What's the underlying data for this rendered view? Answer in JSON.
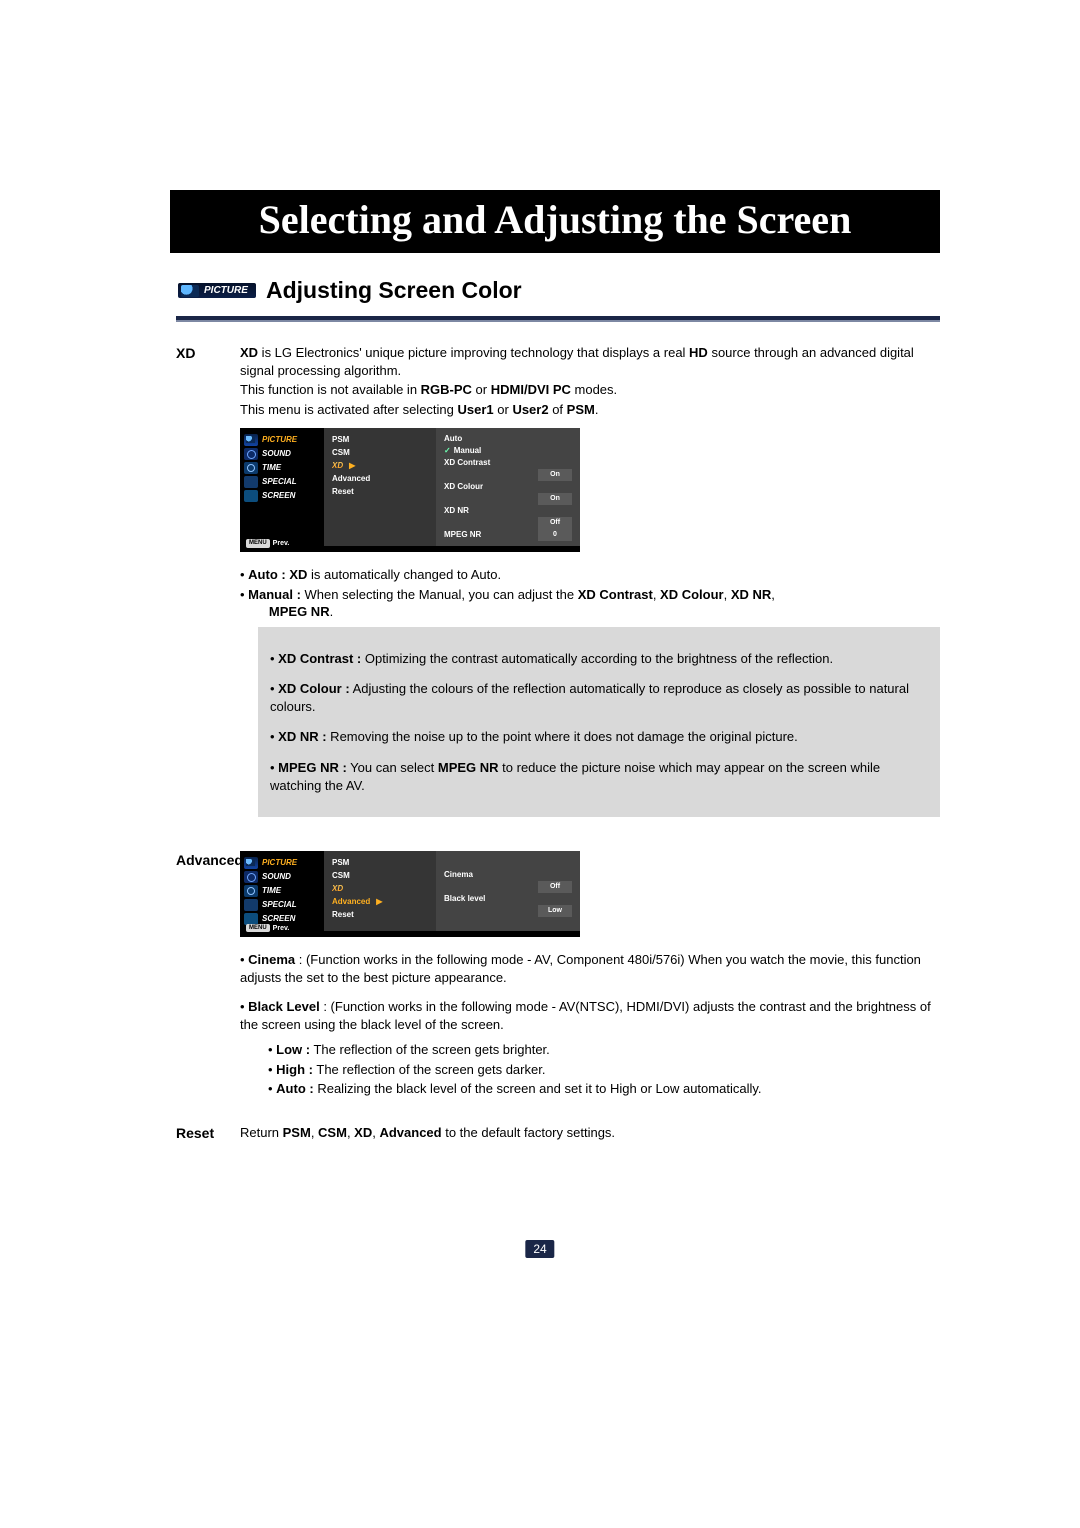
{
  "banner": "Selecting and Adjusting the Screen",
  "picture_chip": "PICTURE",
  "subtitle": "Adjusting Screen Color",
  "page_number": "24",
  "xd": {
    "label": "XD",
    "intro": {
      "b1": "XD",
      "t1": " is LG Electronics' unique picture improving technology that displays a real ",
      "b2": "HD",
      "t2": " source through an advanced digital signal processing algorithm."
    },
    "line2": {
      "t1": "This function is not available in ",
      "b1": "RGB-PC",
      "t2": " or ",
      "b2": "HDMI/DVI PC",
      "t3": " modes."
    },
    "line3": {
      "t1": "This menu is activated after selecting ",
      "b1": "User1",
      "t2": " or ",
      "b2": "User2",
      "t3": " of ",
      "b3": "PSM",
      "t4": "."
    },
    "auto": {
      "b": "Auto : XD",
      "t": " is automatically changed to Auto."
    },
    "manual": {
      "b": "Manual :",
      "t": " When selecting the Manual, you can adjust the ",
      "b2": "XD Contrast",
      "b3": "XD Colour",
      "b4": "XD NR",
      "b5": "MPEG NR",
      "sep": ", "
    },
    "box": {
      "c": {
        "b": "XD Contrast :",
        "t": " Optimizing the contrast automatically according to the brightness of the reflection."
      },
      "col": {
        "b": "XD Colour :",
        "t": " Adjusting the colours of the reflection automatically to reproduce as closely as possible to natural colours."
      },
      "nr": {
        "b": "XD NR :",
        "t": " Removing the noise up to the point where it does not damage the original picture."
      },
      "mp": {
        "b": "MPEG NR :",
        "t1": " You can select ",
        "b2": "MPEG NR",
        "t2": " to reduce the picture noise which may appear on the screen while watching the AV."
      }
    }
  },
  "osd1": {
    "cats": [
      "PICTURE",
      "SOUND",
      "TIME",
      "SPECIAL",
      "SCREEN"
    ],
    "mid": [
      "PSM",
      "CSM",
      "XD",
      "Advanced",
      "Reset"
    ],
    "mid_sel_idx": 2,
    "arrow": "▶",
    "right": [
      {
        "label": "Auto"
      },
      {
        "label": "Manual",
        "check": "✓"
      },
      {
        "label": "XD Contrast",
        "val": "On"
      },
      {
        "label": "XD Colour",
        "val": "On"
      },
      {
        "label": "XD NR",
        "val": "Off"
      },
      {
        "label": "MPEG NR",
        "val": "0"
      }
    ],
    "menu": "MENU",
    "prev": "Prev."
  },
  "advanced": {
    "label": "Advanced",
    "cinema": {
      "b": "Cinema",
      "t": " : (Function works in the following mode - AV, Component 480i/576i) When you watch the movie, this function adjusts the set to the best picture appearance."
    },
    "black": {
      "b": "Black Level",
      "t": " : (Function works in the following mode - AV(NTSC), HDMI/DVI) adjusts the contrast and the brightness of the screen using the black level of the screen."
    },
    "low": {
      "b": "Low :",
      "t": " The reflection of the screen gets brighter."
    },
    "high": {
      "b": "High :",
      "t": " The reflection of the screen gets darker."
    },
    "auto": {
      "b": "Auto :",
      "t": " Realizing the black level of the screen and set it to High or Low automatically."
    }
  },
  "osd2": {
    "cats": [
      "PICTURE",
      "SOUND",
      "TIME",
      "SPECIAL",
      "SCREEN"
    ],
    "mid": [
      "PSM",
      "CSM",
      "XD",
      "Advanced",
      "Reset"
    ],
    "mid_sel_idx": 3,
    "arrow": "▶",
    "right": [
      {
        "label": "Cinema",
        "val": "Off"
      },
      {
        "label": "Black level",
        "val": "Low"
      }
    ],
    "menu": "MENU",
    "prev": "Prev."
  },
  "reset": {
    "label": "Reset",
    "t1": "Return ",
    "b1": "PSM",
    "b2": "CSM",
    "b3": "XD",
    "b4": "Advanced",
    "t2": " to  the default factory settings.",
    "sep": ", "
  }
}
